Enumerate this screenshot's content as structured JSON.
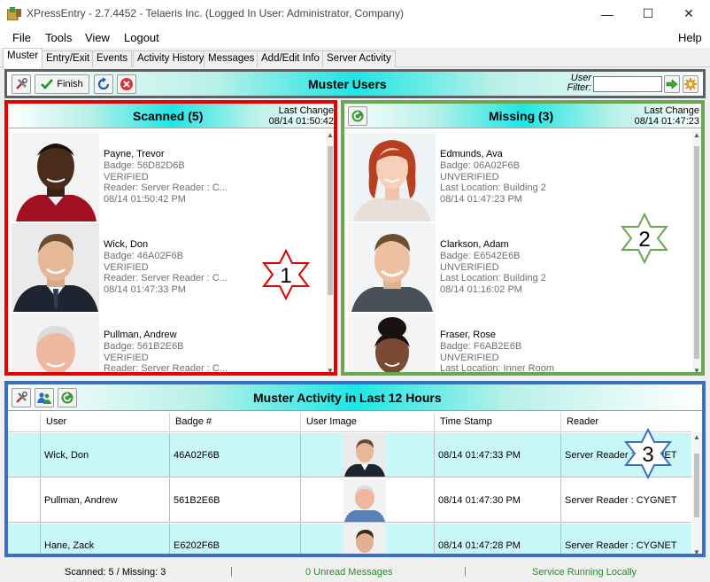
{
  "window": {
    "title": "XPressEntry - 2.7.4452 - Telaeris Inc. (Logged In User: Administrator, Company)",
    "minimize": "—",
    "maximize": "☐",
    "close": "✕"
  },
  "menu": {
    "items": [
      "File",
      "Tools",
      "View",
      "Logout"
    ],
    "help": "Help"
  },
  "tabs": [
    {
      "label": "Muster",
      "active": true
    },
    {
      "label": "Entry/Exit"
    },
    {
      "label": "Events"
    },
    {
      "label": "Activity History"
    },
    {
      "label": "Messages"
    },
    {
      "label": "Add/Edit Info"
    },
    {
      "label": "Server Activity"
    }
  ],
  "muster": {
    "title": "Muster Users",
    "finish_label": "Finish",
    "filter_label_1": "User",
    "filter_label_2": "Filter:",
    "filter_value": ""
  },
  "scanned": {
    "title": "Scanned (5)",
    "last_change_label": "Last Change",
    "last_change_time": "08/14 01:50:42",
    "people": [
      {
        "name": "Payne, Trevor",
        "badge": "Badge: 56D82D6B",
        "status": "VERIFIED",
        "detail": "Reader: Server Reader : C...",
        "time": "08/14 01:50:42 PM"
      },
      {
        "name": "Wick, Don",
        "badge": "Badge: 46A02F6B",
        "status": "VERIFIED",
        "detail": "Reader: Server Reader : C...",
        "time": "08/14 01:47:33 PM"
      },
      {
        "name": "Pullman, Andrew",
        "badge": "Badge: 561B2E6B",
        "status": "VERIFIED",
        "detail": "Reader: Server Reader : C...",
        "time": ""
      }
    ]
  },
  "missing": {
    "title": "Missing (3)",
    "last_change_label": "Last Change",
    "last_change_time": "08/14 01:47:23",
    "people": [
      {
        "name": "Edmunds, Ava",
        "badge": "Badge: 06A02F6B",
        "status": "UNVERIFIED",
        "detail": "Last Location: Building 2",
        "time": "08/14 01:47:23 PM"
      },
      {
        "name": "Clarkson, Adam",
        "badge": "Badge: E6542E6B",
        "status": "UNVERIFIED",
        "detail": "Last Location: Building 2",
        "time": "08/14 01:16:02 PM"
      },
      {
        "name": "Fraser, Rose",
        "badge": "Badge: F6AB2E6B",
        "status": "UNVERIFIED",
        "detail": "Last Location: Inner Room",
        "time": ""
      }
    ]
  },
  "activity": {
    "title": "Muster Activity in Last 12 Hours",
    "columns": [
      "User",
      "Badge #",
      "User Image",
      "Time Stamp",
      "Reader"
    ],
    "rows": [
      {
        "user": "Wick, Don",
        "badge": "46A02F6B",
        "time": "08/14 01:47:33 PM",
        "reader": "Server Reader : CYGNET"
      },
      {
        "user": "Pullman, Andrew",
        "badge": "561B2E6B",
        "time": "08/14 01:47:30 PM",
        "reader": "Server Reader : CYGNET"
      },
      {
        "user": "Hane, Zack",
        "badge": "E6202F6B",
        "time": "08/14 01:47:28 PM",
        "reader": "Server Reader : CYGNET"
      }
    ]
  },
  "status": {
    "counts": "Scanned: 5 / Missing: 3",
    "messages": "0 Unread Messages",
    "service": "Service Running Locally",
    "separator": "|"
  },
  "annotations": {
    "star_1": "1",
    "star_2": "2",
    "star_3": "3"
  },
  "colors": {
    "scanned_border": "#e50000",
    "missing_border": "#6aa84f",
    "activity_border": "#3a6fc4",
    "header_cyan": "#1ee6e6",
    "status_green": "#2a8a2a"
  }
}
